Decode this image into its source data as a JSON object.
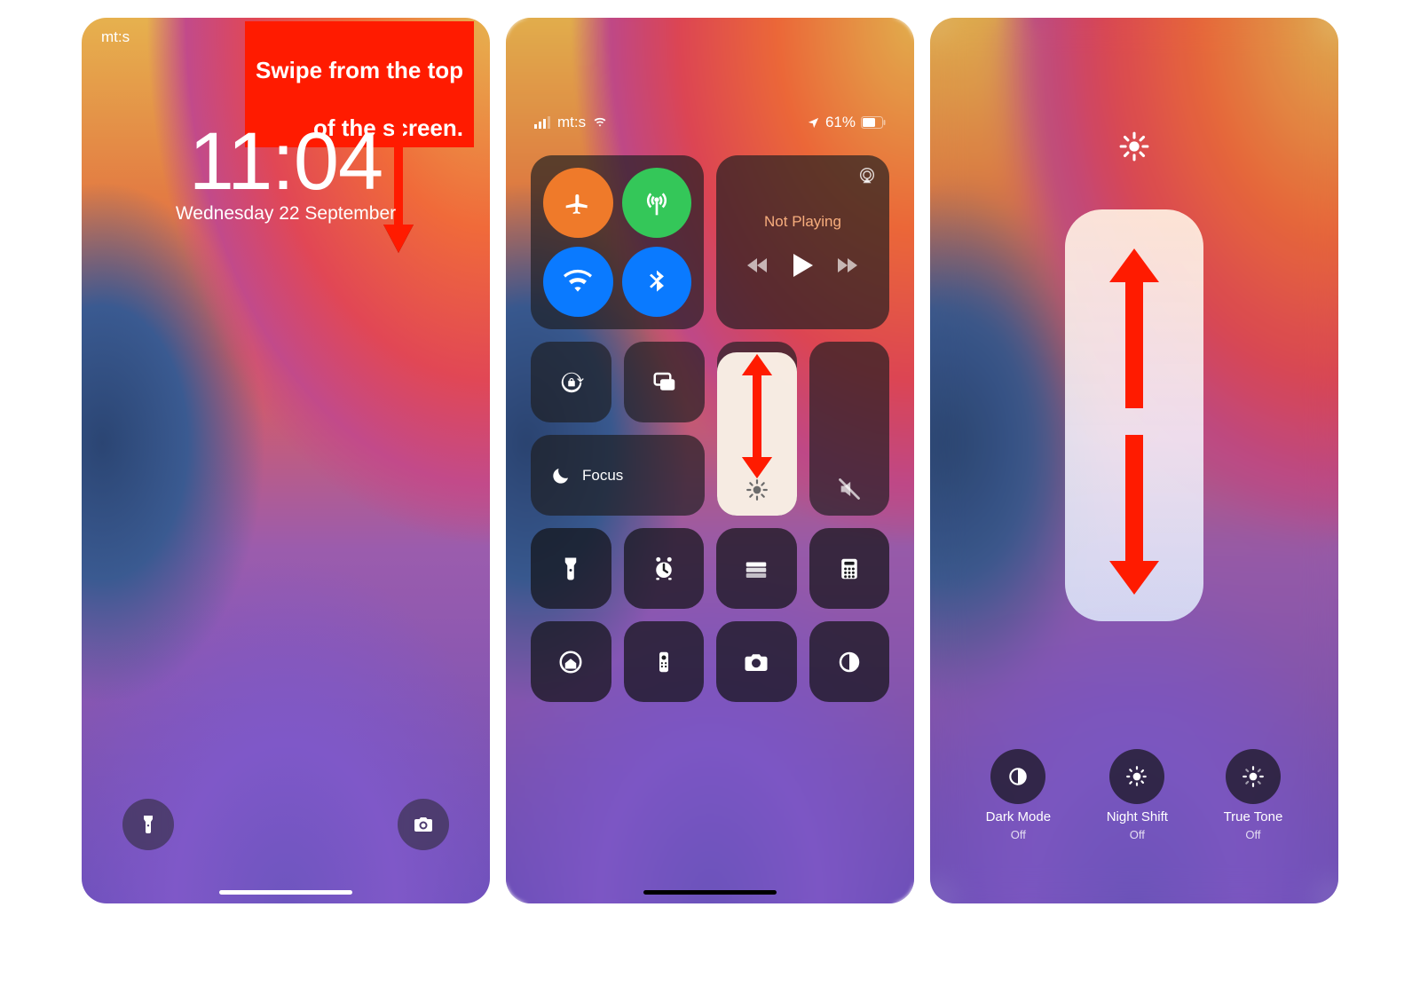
{
  "annotation": {
    "callout_line1": "Swipe from the top",
    "callout_line2": "of the screen.",
    "arrow_color": "#ff1b00"
  },
  "panel1": {
    "carrier": "mt:s",
    "time": "11:04",
    "date": "Wednesday 22 September"
  },
  "panel2": {
    "status": {
      "carrier": "mt:s",
      "battery_pct": "61%"
    },
    "connectivity": {
      "airplane": {
        "enabled": true,
        "color": "#ef7a2a"
      },
      "cellular": {
        "enabled": true,
        "color": "#34c759"
      },
      "wifi": {
        "enabled": true,
        "color": "#0a7aff"
      },
      "bluetooth": {
        "enabled": true,
        "color": "#0a7aff"
      }
    },
    "media": {
      "now_playing": "Not Playing"
    },
    "focus_label": "Focus",
    "brightness_fill_pct": 94,
    "volume_fill_pct": 0,
    "quick_icons_row1": [
      "flashlight",
      "alarm",
      "wallet",
      "calculator"
    ],
    "quick_icons_row2": [
      "home",
      "apple-tv-remote",
      "camera",
      "dark-mode"
    ]
  },
  "panel3": {
    "options": [
      {
        "key": "dark-mode",
        "label": "Dark Mode",
        "state": "Off"
      },
      {
        "key": "night-shift",
        "label": "Night Shift",
        "state": "Off"
      },
      {
        "key": "true-tone",
        "label": "True Tone",
        "state": "Off"
      }
    ]
  }
}
